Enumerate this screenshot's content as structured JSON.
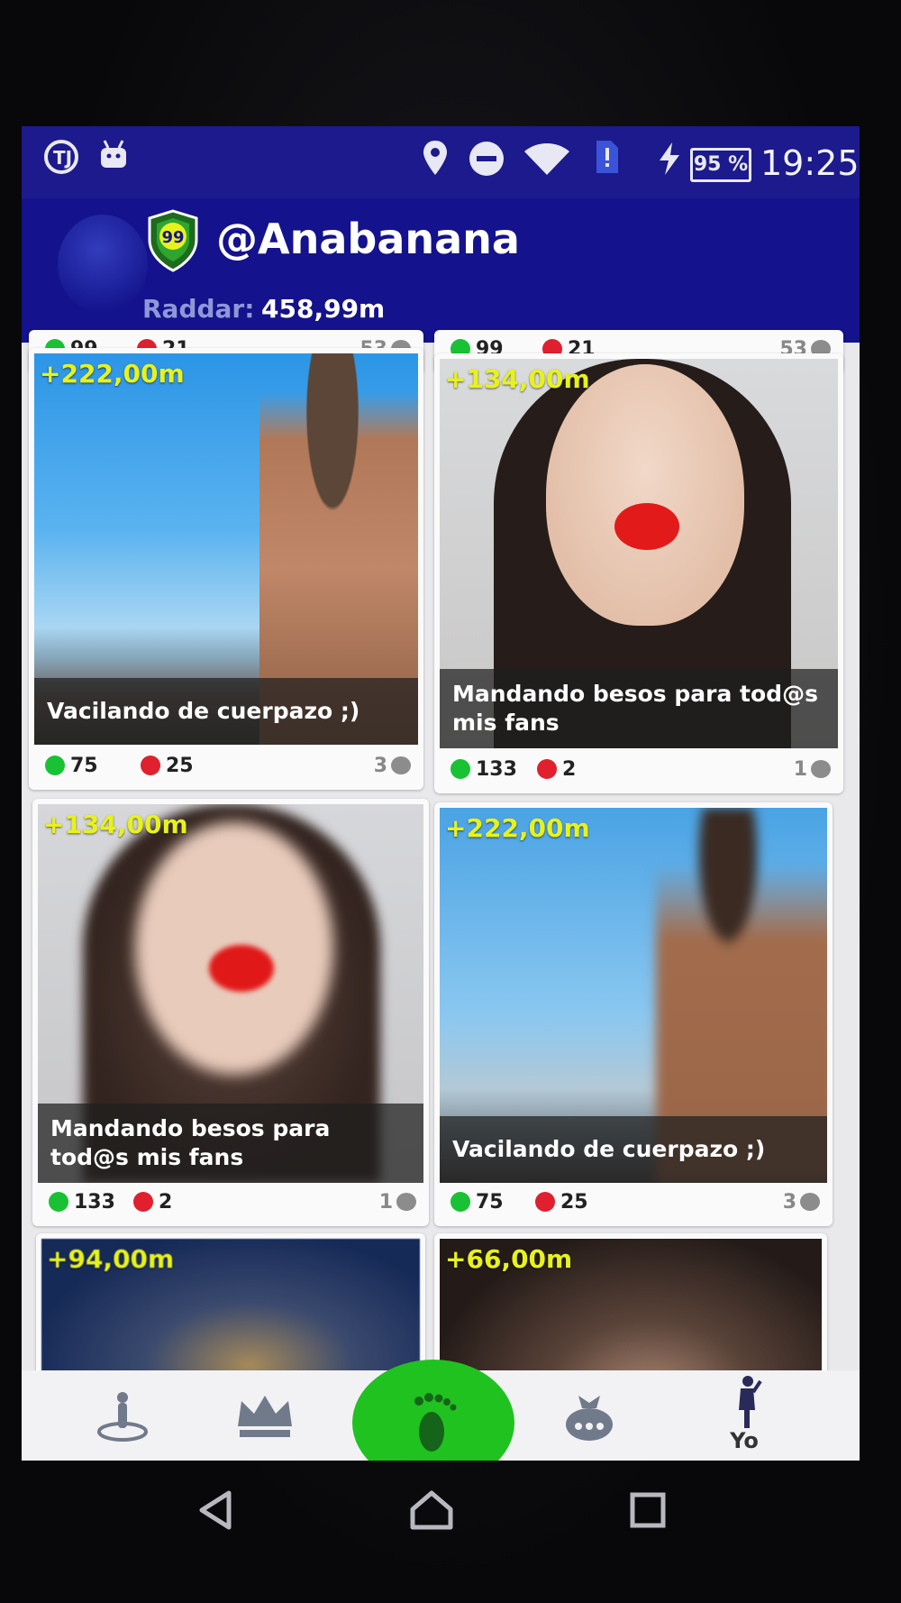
{
  "status_bar": {
    "time": "19:25",
    "battery": "95 %",
    "icons": [
      "app-j-icon",
      "android-icon",
      "location-icon",
      "do-not-disturb-icon",
      "wifi-icon",
      "sim-alert-icon",
      "charging-icon"
    ]
  },
  "header": {
    "username": "@Anabanana",
    "level_badge": "99",
    "raddar_label": "Raddar:",
    "raddar_value": "458,99m"
  },
  "partial_row": {
    "left": {
      "likes": "99",
      "dislikes": "21",
      "comments": "53"
    },
    "right": {
      "likes": "99",
      "dislikes": "21",
      "comments": "53"
    }
  },
  "cards": [
    {
      "distance": "+222,00m",
      "caption": "Vacilando de cuerpazo ;)",
      "likes": "75",
      "dislikes": "25",
      "comments": "3"
    },
    {
      "distance": "+134,00m",
      "caption": "Mandando besos para tod@s mis fans",
      "likes": "133",
      "dislikes": "2",
      "comments": "1"
    },
    {
      "distance": "+134,00m",
      "caption": "Mandando besos para tod@s mis fans",
      "likes": "133",
      "dislikes": "2",
      "comments": "1"
    },
    {
      "distance": "+222,00m",
      "caption": "Vacilando de cuerpazo ;)",
      "likes": "75",
      "dislikes": "25",
      "comments": "3"
    },
    {
      "distance": "+94,00m"
    },
    {
      "distance": "+66,00m"
    }
  ],
  "bottom_nav": {
    "items": [
      "radar-person-icon",
      "crown-icon",
      "footprint-icon",
      "treasure-bag-icon",
      "profile-icon"
    ],
    "yo_label": "Yo",
    "active_color": "#20c21f"
  },
  "colors": {
    "header": "#14128c",
    "distance": "#e7f21c",
    "like": "#19c234",
    "dislike": "#e0202e"
  }
}
